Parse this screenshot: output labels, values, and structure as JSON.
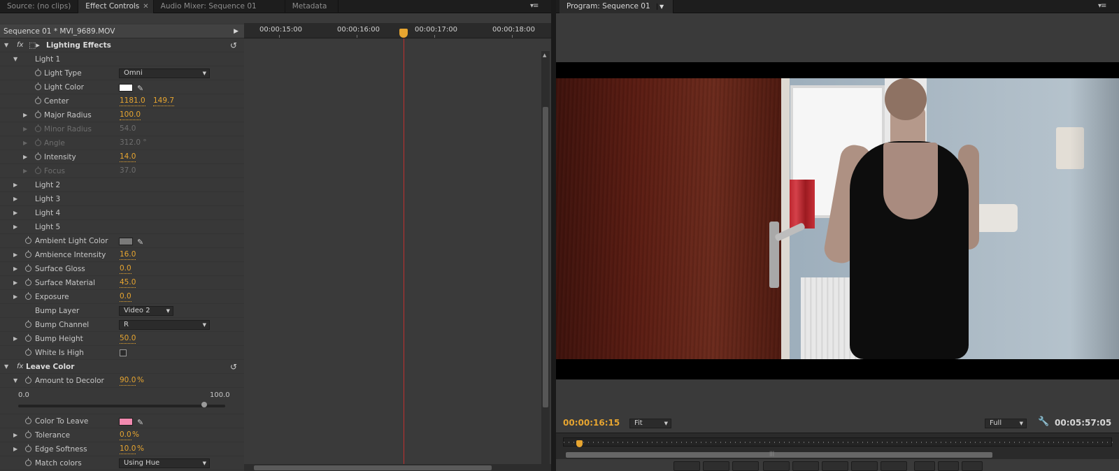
{
  "left_tabs": [
    {
      "label": "Source: (no clips)",
      "active": false
    },
    {
      "label": "Effect Controls",
      "active": true,
      "closable": true
    },
    {
      "label": "Audio Mixer: Sequence 01",
      "active": false
    },
    {
      "label": "Metadata",
      "active": false
    }
  ],
  "right_tabs": [
    {
      "label": "Program: Sequence 01",
      "active": true,
      "dropdown": true
    }
  ],
  "sequence_header": "Sequence 01 * MVI_9689.MOV",
  "ruler": {
    "timecodes": [
      "00:00:15:00",
      "00:00:16:00",
      "00:00:17:00",
      "00:00:18:00"
    ]
  },
  "effects": {
    "lighting": {
      "fx_label": "fx",
      "name": "Lighting Effects",
      "light1": "Light 1",
      "light_type": {
        "label": "Light Type",
        "value": "Omni"
      },
      "light_color": {
        "label": "Light Color",
        "color": "#ffffff"
      },
      "center": {
        "label": "Center",
        "x": "1181.0",
        "y": "149.7"
      },
      "major_radius": {
        "label": "Major Radius",
        "value": "100.0"
      },
      "minor_radius": {
        "label": "Minor Radius",
        "value": "54.0"
      },
      "angle": {
        "label": "Angle",
        "value": "312.0 °"
      },
      "intensity": {
        "label": "Intensity",
        "value": "14.0"
      },
      "focus": {
        "label": "Focus",
        "value": "37.0"
      },
      "light2": "Light 2",
      "light3": "Light 3",
      "light4": "Light 4",
      "light5": "Light 5",
      "ambient_light_color": {
        "label": "Ambient Light Color",
        "color": "#7a7a7a"
      },
      "ambience_intensity": {
        "label": "Ambience Intensity",
        "value": "16.0"
      },
      "surface_gloss": {
        "label": "Surface Gloss",
        "value": "0.0"
      },
      "surface_material": {
        "label": "Surface Material",
        "value": "45.0"
      },
      "exposure": {
        "label": "Exposure",
        "value": "0.0"
      },
      "bump_layer": {
        "label": "Bump Layer",
        "value": "Video 2"
      },
      "bump_channel": {
        "label": "Bump Channel",
        "value": "R"
      },
      "bump_height": {
        "label": "Bump Height",
        "value": "50.0"
      },
      "white_is_high": {
        "label": "White Is High",
        "checked": false
      }
    },
    "leave_color": {
      "fx_label": "fx",
      "name": "Leave Color",
      "amount_to_decolor": {
        "label": "Amount to Decolor",
        "value": "90.0",
        "unit": "%"
      },
      "slider_min": "0.0",
      "slider_max": "100.0",
      "slider_level": 0.9,
      "color_to_leave": {
        "label": "Color To Leave",
        "color": "#f28ab0"
      },
      "tolerance": {
        "label": "Tolerance",
        "value": "0.0",
        "unit": "%"
      },
      "edge_softness": {
        "label": "Edge Softness",
        "value": "10.0",
        "unit": "%"
      },
      "match_colors": {
        "label": "Match colors",
        "value": "Using Hue"
      }
    }
  },
  "program": {
    "current_timecode": "00:00:16:15",
    "zoom": "Fit",
    "resolution": "Full",
    "duration": "00:05:57:05"
  },
  "colors": {
    "accent": "#e7a530",
    "playhead": "#c0302e",
    "panel_bg": "#3a3a3a"
  }
}
